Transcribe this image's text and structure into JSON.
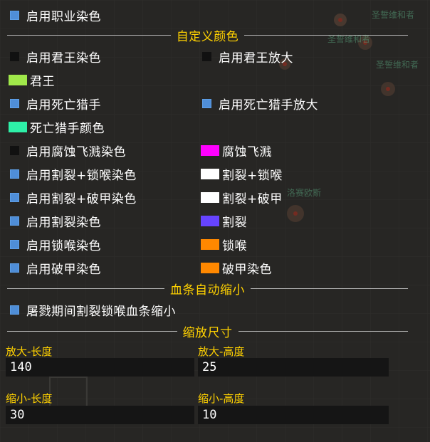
{
  "top_checkbox": {
    "label": "启用职业染色",
    "checked": true
  },
  "section_custom_colors": {
    "title": "自定义颜色"
  },
  "custom_rows": [
    {
      "left": {
        "kind": "checkbox",
        "label": "启用君王染色",
        "checked": false
      },
      "right": {
        "kind": "checkbox",
        "label": "启用君王放大",
        "checked": false
      }
    },
    {
      "left": {
        "kind": "swatch",
        "label": "君王",
        "color": "#a0e84a"
      }
    },
    {
      "left": {
        "kind": "checkbox",
        "label": "启用死亡猎手",
        "checked": true
      },
      "right": {
        "kind": "checkbox",
        "label": "启用死亡猎手放大",
        "checked": true
      }
    },
    {
      "left": {
        "kind": "swatch",
        "label": "死亡猎手颜色",
        "color": "#2ef0a8"
      }
    },
    {
      "left": {
        "kind": "checkbox",
        "label": "启用腐蚀飞溅染色",
        "checked": false
      },
      "right": {
        "kind": "swatch",
        "label": "腐蚀飞溅",
        "color": "#ff00ff"
      }
    },
    {
      "left": {
        "kind": "checkbox",
        "label": "启用割裂+锁喉染色",
        "checked": true
      },
      "right": {
        "kind": "swatch",
        "label": "割裂+锁喉",
        "color": "#ffffff"
      }
    },
    {
      "left": {
        "kind": "checkbox",
        "label": "启用割裂+破甲染色",
        "checked": true
      },
      "right": {
        "kind": "swatch",
        "label": "割裂+破甲",
        "color": "#ffffff"
      }
    },
    {
      "left": {
        "kind": "checkbox",
        "label": "启用割裂染色",
        "checked": true
      },
      "right": {
        "kind": "swatch",
        "label": "割裂",
        "color": "#6644ff"
      }
    },
    {
      "left": {
        "kind": "checkbox",
        "label": "启用锁喉染色",
        "checked": true
      },
      "right": {
        "kind": "swatch",
        "label": "锁喉",
        "color": "#ff8800"
      }
    },
    {
      "left": {
        "kind": "checkbox",
        "label": "启用破甲染色",
        "checked": true
      },
      "right": {
        "kind": "swatch",
        "label": "破甲染色",
        "color": "#ff8800"
      }
    }
  ],
  "section_healthbar": {
    "title": "血条自动缩小"
  },
  "healthbar_checkbox": {
    "label": "屠戮期间割裂锁喉血条缩小",
    "checked": true
  },
  "section_scale": {
    "title": "缩放尺寸"
  },
  "scale_fields": {
    "enlarge_length": {
      "label": "放大-长度",
      "value": "140"
    },
    "enlarge_height": {
      "label": "放大-高度",
      "value": "25"
    },
    "shrink_length": {
      "label": "缩小-长度",
      "value": "30"
    },
    "shrink_height": {
      "label": "缩小-高度",
      "value": "10"
    }
  },
  "background_labels": [
    "圣誓维和者",
    "圣誓维和者",
    "圣誓维和者",
    "洛赛欧斯"
  ]
}
